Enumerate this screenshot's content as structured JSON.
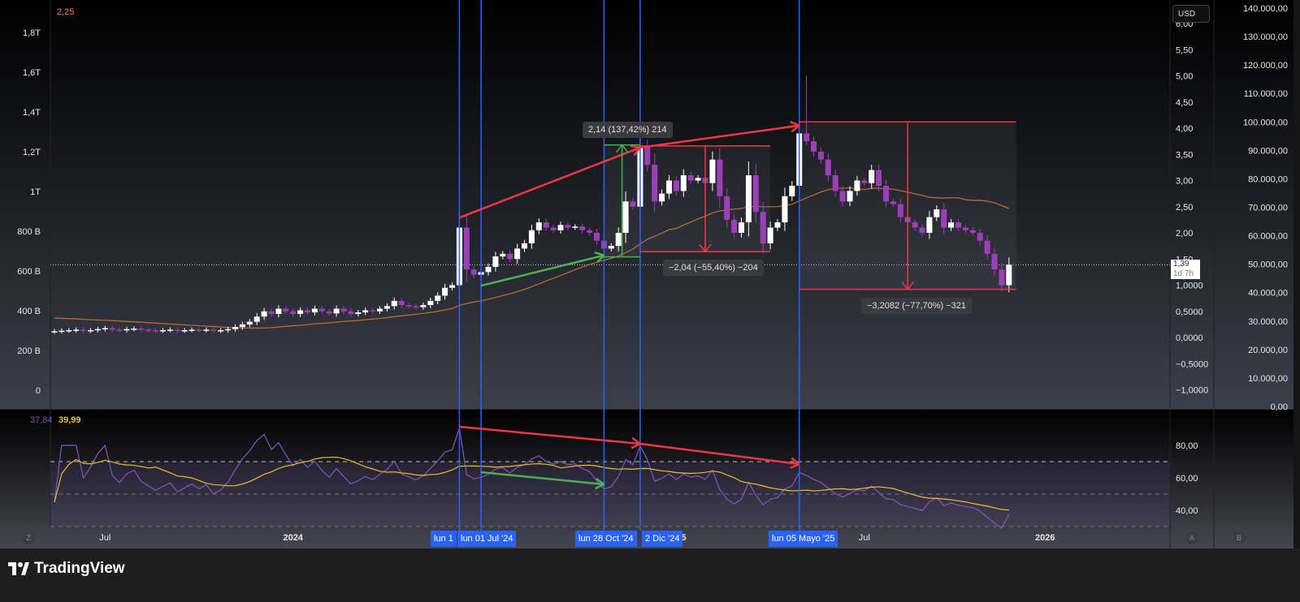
{
  "header": {
    "overlay_value": "2,25",
    "currency_button": "USD"
  },
  "price_tag": {
    "value": "1,39",
    "countdown": "1d 7h"
  },
  "brand": {
    "name": "TradingView"
  },
  "axis_buttons": {
    "left": "Z",
    "a": "A",
    "b": "B"
  },
  "colors": {
    "up": "#ffffff",
    "down": "#9c3fb8",
    "ma": "#c0702a",
    "rsi": "#7e57c2",
    "rsi_ma": "#e6c229",
    "marker": "#2962ff",
    "red": "#f23645",
    "green": "#4caf50"
  },
  "chart_data": [
    {
      "type": "candlestick",
      "title": "",
      "interval": "weekly",
      "left_axis": {
        "ticks": [
          "0",
          "200 B",
          "400 B",
          "600 B",
          "800 B",
          "1T",
          "1,2T",
          "1,4T",
          "1,6T",
          "1,8T"
        ],
        "values": [
          0,
          200,
          400,
          600,
          800,
          1000,
          1200,
          1400,
          1600,
          1800
        ],
        "unit": "B"
      },
      "inner_axis": {
        "ticks": [
          "−1,0000",
          "−0,5000",
          "0,0000",
          "0,5000",
          "1,0000",
          "1,50",
          "2,00",
          "2,50",
          "3,00",
          "3,50",
          "4,00",
          "4,50",
          "5,00",
          "5,50",
          "6,00"
        ],
        "values": [
          -1,
          -0.5,
          0,
          0.5,
          1,
          1.5,
          2,
          2.5,
          3,
          3.5,
          4,
          4.5,
          5,
          5.5,
          6
        ]
      },
      "outer_axis": {
        "ticks": [
          "0,00",
          "10.000,00",
          "20.000,00",
          "30.000,00",
          "40.000,00",
          "50.000,00",
          "60.000,00",
          "70.000,00",
          "80.000,00",
          "90.000,00",
          "100.000,00",
          "110.000,00",
          "120.000,00",
          "130.000,00",
          "140.000,00"
        ],
        "values": [
          0,
          10000,
          20000,
          30000,
          40000,
          50000,
          60000,
          70000,
          80000,
          90000,
          100000,
          110000,
          120000,
          130000,
          140000
        ]
      },
      "x_ticks": [
        {
          "label": "Jul",
          "week": 7
        },
        {
          "label": "2024",
          "week": 33
        },
        {
          "label": "2025",
          "week": 86
        },
        {
          "label": "Jul",
          "week": 112
        },
        {
          "label": "2026",
          "week": 137
        }
      ],
      "closes": [
        0.12,
        0.13,
        0.14,
        0.15,
        0.13,
        0.14,
        0.16,
        0.18,
        0.15,
        0.14,
        0.16,
        0.17,
        0.15,
        0.14,
        0.13,
        0.14,
        0.15,
        0.13,
        0.14,
        0.15,
        0.14,
        0.15,
        0.13,
        0.14,
        0.16,
        0.2,
        0.25,
        0.3,
        0.4,
        0.5,
        0.45,
        0.55,
        0.5,
        0.45,
        0.52,
        0.48,
        0.55,
        0.5,
        0.46,
        0.55,
        0.5,
        0.45,
        0.48,
        0.52,
        0.5,
        0.55,
        0.6,
        0.7,
        0.62,
        0.6,
        0.58,
        0.62,
        0.7,
        0.8,
        0.95,
        1.0,
        2.1,
        1.3,
        1.2,
        1.25,
        1.35,
        1.55,
        1.6,
        1.5,
        1.7,
        1.8,
        2.05,
        2.2,
        2.1,
        2.05,
        2.15,
        2.1,
        2.12,
        2.05,
        2.0,
        1.85,
        1.7,
        1.75,
        2.0,
        2.6,
        2.5,
        3.65,
        3.3,
        2.6,
        2.75,
        3.0,
        2.8,
        3.1,
        3.0,
        3.05,
        2.95,
        3.4,
        2.7,
        2.25,
        2.0,
        2.2,
        3.1,
        2.4,
        1.8,
        2.1,
        2.2,
        2.7,
        2.9,
        3.9,
        3.75,
        3.55,
        3.4,
        3.1,
        2.8,
        2.6,
        2.8,
        3.0,
        2.95,
        3.2,
        2.9,
        2.6,
        2.55,
        2.3,
        2.2,
        2.1,
        2.0,
        2.3,
        2.45,
        2.1,
        2.2,
        2.1,
        2.05,
        2.0,
        1.85,
        1.6,
        1.3,
        1.0,
        1.39
      ],
      "peak_high": {
        "week": 104,
        "value": 5.0
      },
      "current_value": 1.39,
      "vertical_markers": [
        {
          "week": 56,
          "label": "lun 1"
        },
        {
          "week": 59,
          "label": "lun 01 Jul '24"
        },
        {
          "week": 76,
          "label": "lun 28 Oct '24"
        },
        {
          "week": 81,
          "label": "2 Dic '24"
        },
        {
          "week": 103,
          "label": "lun 05 Mayo '25"
        }
      ],
      "trend_lines": [
        {
          "color": "red",
          "from": {
            "week": 56,
            "value": 2.29
          },
          "to": {
            "week": 81,
            "value": 3.63
          }
        },
        {
          "color": "red",
          "from": {
            "week": 81,
            "value": 3.63
          },
          "to": {
            "week": 103,
            "value": 4.05
          }
        },
        {
          "color": "green",
          "from": {
            "week": 59,
            "value": 0.99
          },
          "to": {
            "week": 76,
            "value": 1.57
          }
        }
      ],
      "measurements": [
        {
          "color": "green",
          "from_week": 76,
          "to_week": 81,
          "from_value": 1.54,
          "to_value": 3.68,
          "label": "2,14 (137,42%) 214"
        },
        {
          "color": "red",
          "from_week": 81,
          "to_week": 99,
          "from_value": 3.66,
          "to_value": 1.64,
          "label": "−2,04 (−55,40%) −204"
        },
        {
          "color": "red",
          "from_week": 103,
          "to_week": 133,
          "from_value": 4.12,
          "to_value": 0.92,
          "label": "−3,2082 (−77,70%) −321"
        }
      ]
    },
    {
      "type": "line",
      "title": "RSI",
      "values_legend": {
        "rsi": "37,84",
        "rsi_ma": "39,99"
      },
      "ticks": [
        "40,00",
        "60,00",
        "80,00"
      ],
      "tick_values": [
        40,
        60,
        80
      ],
      "bands": [
        30,
        50,
        70
      ],
      "trend_lines": [
        {
          "color": "red",
          "from": {
            "week": 56,
            "value": 91.5
          },
          "to": {
            "week": 81,
            "value": 81
          }
        },
        {
          "color": "red",
          "from": {
            "week": 81,
            "value": 81
          },
          "to": {
            "week": 103,
            "value": 68.5
          }
        },
        {
          "color": "green",
          "from": {
            "week": 59,
            "value": 63.5
          },
          "to": {
            "week": 76,
            "value": 56
          }
        }
      ]
    }
  ]
}
